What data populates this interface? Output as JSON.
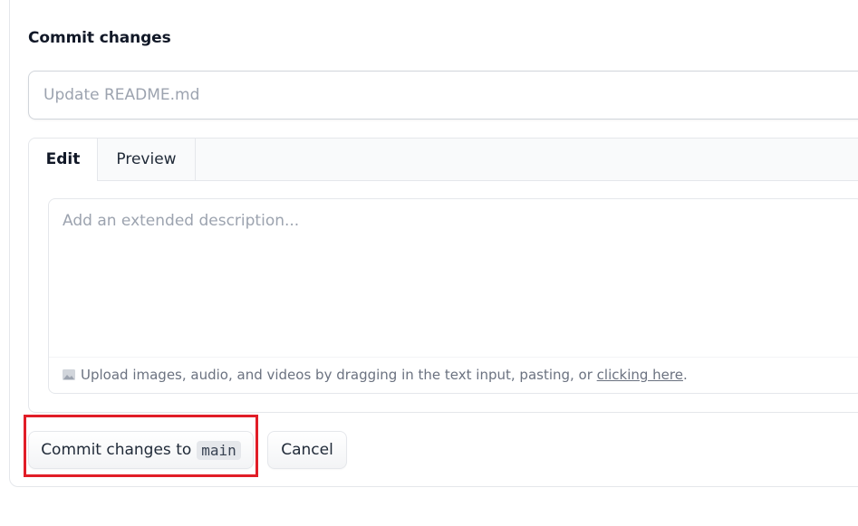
{
  "commit": {
    "title": "Commit changes",
    "summary_placeholder": "Update README.md",
    "summary_value": "",
    "tabs": [
      {
        "label": "Edit",
        "active": true
      },
      {
        "label": "Preview",
        "active": false
      }
    ],
    "description_placeholder": "Add an extended description...",
    "description_value": "",
    "upload_hint": "Upload images, audio, and videos by dragging in the text input, pasting, or ",
    "upload_link": "clicking here",
    "upload_suffix": ".",
    "commit_button_label": "Commit changes to",
    "branch": "main",
    "cancel_button_label": "Cancel"
  },
  "icons": {
    "upload": "image-icon"
  },
  "colors": {
    "highlight_border": "#e11d27",
    "placeholder": "#9ca3af",
    "border": "#e5e7eb"
  }
}
